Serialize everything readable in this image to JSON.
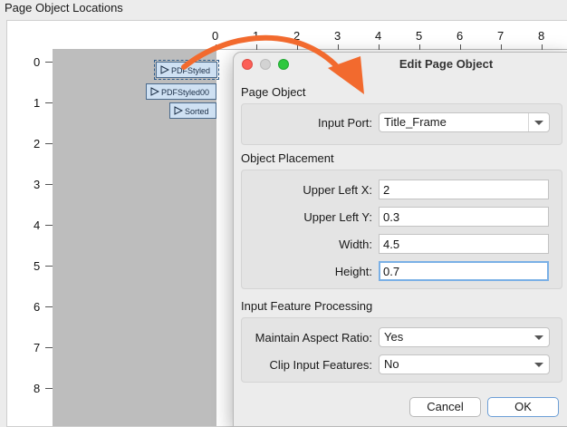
{
  "window": {
    "title": "Page Object Locations"
  },
  "ruler": {
    "x_labels": [
      "0",
      "1",
      "2",
      "3",
      "4",
      "5",
      "6",
      "7",
      "8"
    ],
    "y_labels": [
      "0",
      "1",
      "2",
      "3",
      "4",
      "5",
      "6",
      "7",
      "8"
    ]
  },
  "nodes": [
    {
      "label": "PDFStyled"
    },
    {
      "label": "PDFStyled00"
    },
    {
      "label": "Sorted"
    }
  ],
  "dialog": {
    "title": "Edit Page Object",
    "page_object_section": "Page Object",
    "input_port_label": "Input Port:",
    "input_port_value": "Title_Frame",
    "placement_section": "Object Placement",
    "upper_left_x_label": "Upper Left X:",
    "upper_left_x_value": "2",
    "upper_left_y_label": "Upper Left Y:",
    "upper_left_y_value": "0.3",
    "width_label": "Width:",
    "width_value": "4.5",
    "height_label": "Height:",
    "height_value": "0.7",
    "processing_section": "Input Feature Processing",
    "maintain_aspect_label": "Maintain Aspect Ratio:",
    "maintain_aspect_value": "Yes",
    "clip_label": "Clip Input Features:",
    "clip_value": "No",
    "cancel_label": "Cancel",
    "ok_label": "OK"
  },
  "colors": {
    "arrow": "#f26a2e",
    "close": "#fc5f57",
    "minimize": "#d3d3d3",
    "zoom": "#2fc83f",
    "node_fill": "#cfe1f3"
  }
}
